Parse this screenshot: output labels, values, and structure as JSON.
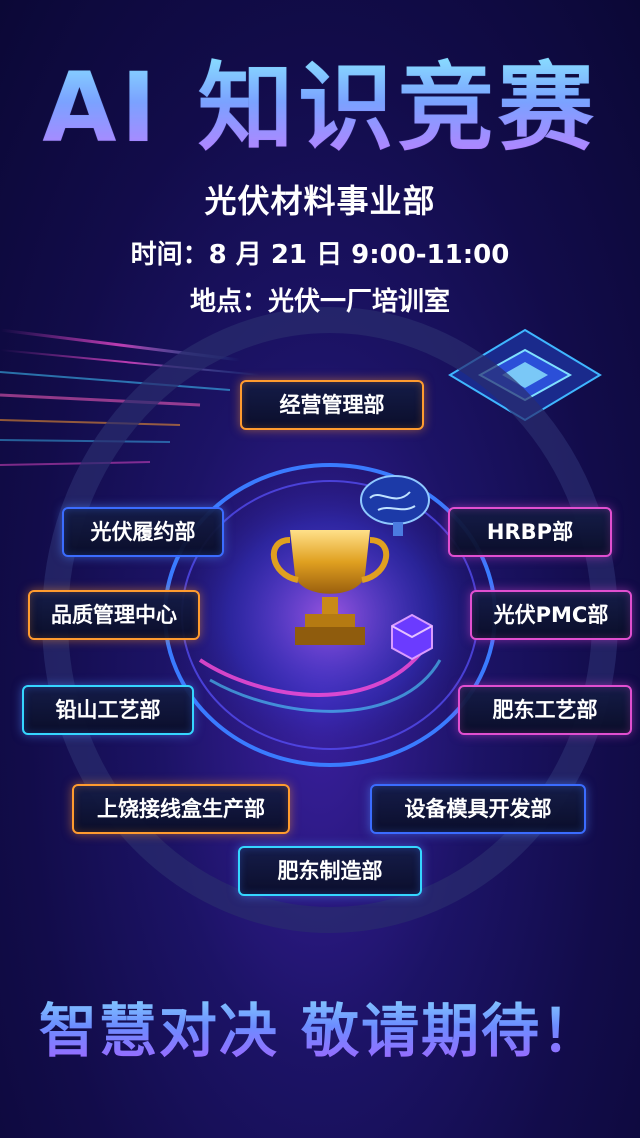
{
  "poster": {
    "title": "AI 知识竞赛",
    "organizer": "光伏材料事业部",
    "time": "时间：8 月 21 日  9:00-11:00",
    "place": "地点：光伏一厂培训室",
    "slogan": "智慧对决  敬请期待！",
    "departments": [
      "经营管理部",
      "光伏履约部",
      "HRBP部",
      "品质管理中心",
      "光伏PMC部",
      "铅山工艺部",
      "肥东工艺部",
      "上饶接线盒生产部",
      "设备模具开发部",
      "肥东制造部"
    ]
  },
  "icons": [
    "trophy-icon",
    "brain-icon",
    "chip-icon",
    "cube-icon"
  ],
  "colors": {
    "accent_blue": "#3b6cff",
    "accent_orange": "#ff9b2f",
    "accent_pink": "#e14fd0",
    "background": "#120c4a"
  }
}
